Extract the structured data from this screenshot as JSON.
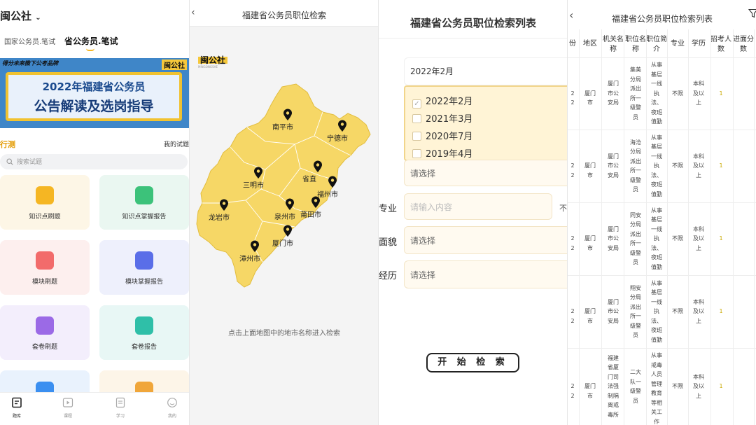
{
  "panel1": {
    "app_title": "闽公社",
    "tabs": [
      "国家公务员.笔试",
      "省公务员.笔试"
    ],
    "banner": {
      "tagline": "得分未来微下公考品牌",
      "logo": "闽公社",
      "line1": "2022年福建省公务员",
      "line2": "公告解读及选岗指导"
    },
    "section_title": "行测",
    "my_exams": "我的试题",
    "search_placeholder": "搜索试题",
    "tiles": [
      {
        "label": "知识点刷题",
        "bg": "#fdf6e6",
        "icon_color": "#f5b623"
      },
      {
        "label": "知识点掌握报告",
        "bg": "#eaf7f1",
        "icon_color": "#3cc27a"
      },
      {
        "label": "模块刷题",
        "bg": "#fdefee",
        "icon_color": "#f26b6b"
      },
      {
        "label": "模块掌握报告",
        "bg": "#eef0fc",
        "icon_color": "#5a6ee8"
      },
      {
        "label": "套卷刷题",
        "bg": "#f3eefc",
        "icon_color": "#9b6ae6"
      },
      {
        "label": "套卷报告",
        "bg": "#e8f7f5",
        "icon_color": "#2fbfa8"
      },
      {
        "label": "",
        "bg": "#e9f2fd",
        "icon_color": "#3b8ff0"
      },
      {
        "label": "",
        "bg": "#fdf5e8",
        "icon_color": "#f0a63a"
      }
    ],
    "nav": [
      "题库",
      "课程",
      "学习",
      "我的"
    ]
  },
  "panel2": {
    "title": "福建省公务员职位检索",
    "logo": "闽公社",
    "logo_sub": "MINGONGSHE",
    "cities": [
      "南平市",
      "宁德市",
      "三明市",
      "省直",
      "福州市",
      "龙岩市",
      "泉州市",
      "莆田市",
      "厦门市",
      "漳州市"
    ],
    "hint": "点击上面地图中的地市名称进入检索",
    "map_color": "#f6d766"
  },
  "panel3": {
    "title": "福建省公务员职位检索列表",
    "selected_year": "2022年2月",
    "options": [
      "2022年2月",
      "2021年3月",
      "2020年7月",
      "2019年4月"
    ],
    "select_ph": "请选择",
    "labels": [
      "专业",
      "面貌",
      "经历"
    ],
    "input_ph": "请输入内容",
    "side_note": "不",
    "start_button": "开 始 检 索"
  },
  "panel4": {
    "title": "福建省公务员职位检索列表",
    "headers": [
      "份",
      "地区",
      "机关名称",
      "职位名称",
      "职位简介",
      "专业",
      "学历",
      "招考人数",
      "进面分数"
    ],
    "rows": [
      {
        "year": "22",
        "region": "厦门市",
        "agency": "厦门市公安局",
        "position": "集美分局派出所一级警员",
        "desc": "从事基层一线执法、夜班值勤",
        "major": "不限",
        "edu": "本科及以上",
        "count": "1"
      },
      {
        "year": "22",
        "region": "厦门市",
        "agency": "厦门市公安局",
        "position": "海沧分局派出所一级警员",
        "desc": "从事基层一线执法、夜班值勤",
        "major": "不限",
        "edu": "本科及以上",
        "count": "1"
      },
      {
        "year": "22",
        "region": "厦门市",
        "agency": "厦门市公安局",
        "position": "同安分局派出所一级警员",
        "desc": "从事基层一线执法、夜班值勤",
        "major": "不限",
        "edu": "本科及以上",
        "count": "1"
      },
      {
        "year": "22",
        "region": "厦门市",
        "agency": "厦门市公安局",
        "position": "翔安分局派出所一级警员",
        "desc": "从事基层一线执法、夜班值勤",
        "major": "不限",
        "edu": "本科及以上",
        "count": "1"
      },
      {
        "year": "22",
        "region": "厦门市",
        "agency": "福建省厦门司法强制隔离戒毒所",
        "position": "二大队一级警员",
        "desc": "从事戒毒人员管理教育等相关工作",
        "major": "不限",
        "edu": "本科及以上",
        "count": "1"
      }
    ]
  }
}
